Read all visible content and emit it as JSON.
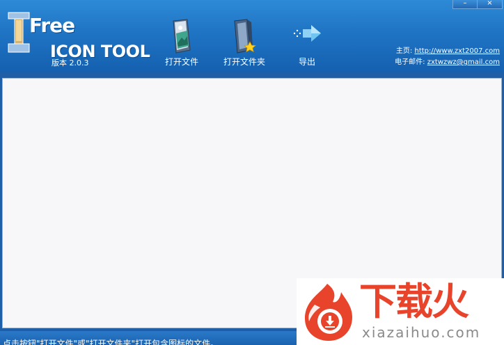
{
  "window": {
    "minimize_symbol": "–",
    "close_symbol": "×"
  },
  "logo": {
    "line1": "Free",
    "line2": "ICON TOOL",
    "version": "版本 2.0.3"
  },
  "toolbar": {
    "open_file_label": "打开文件",
    "open_folder_label": "打开文件夹",
    "export_label": "导出"
  },
  "links": {
    "homepage_label": "主页: ",
    "homepage_url": "http://www.zxt2007.com",
    "email_label": "电子邮件: ",
    "email_value": "zxtwzwz@gmail.com"
  },
  "status": {
    "text": "点击按钮\"打开文件\"或\"打开文件夹\"打开包含图标的文件。"
  },
  "watermark": {
    "cn": "下载火",
    "en": "xiazaihuo.com"
  },
  "colors": {
    "header_top": "#2d8ad6",
    "header_bottom": "#1560b0",
    "content_bg": "#f7f6f9",
    "watermark_red": "#e8442b"
  },
  "icons": {
    "open_file": "document-image-icon",
    "open_folder": "folder-star-icon",
    "export": "arrow-right-icon"
  }
}
